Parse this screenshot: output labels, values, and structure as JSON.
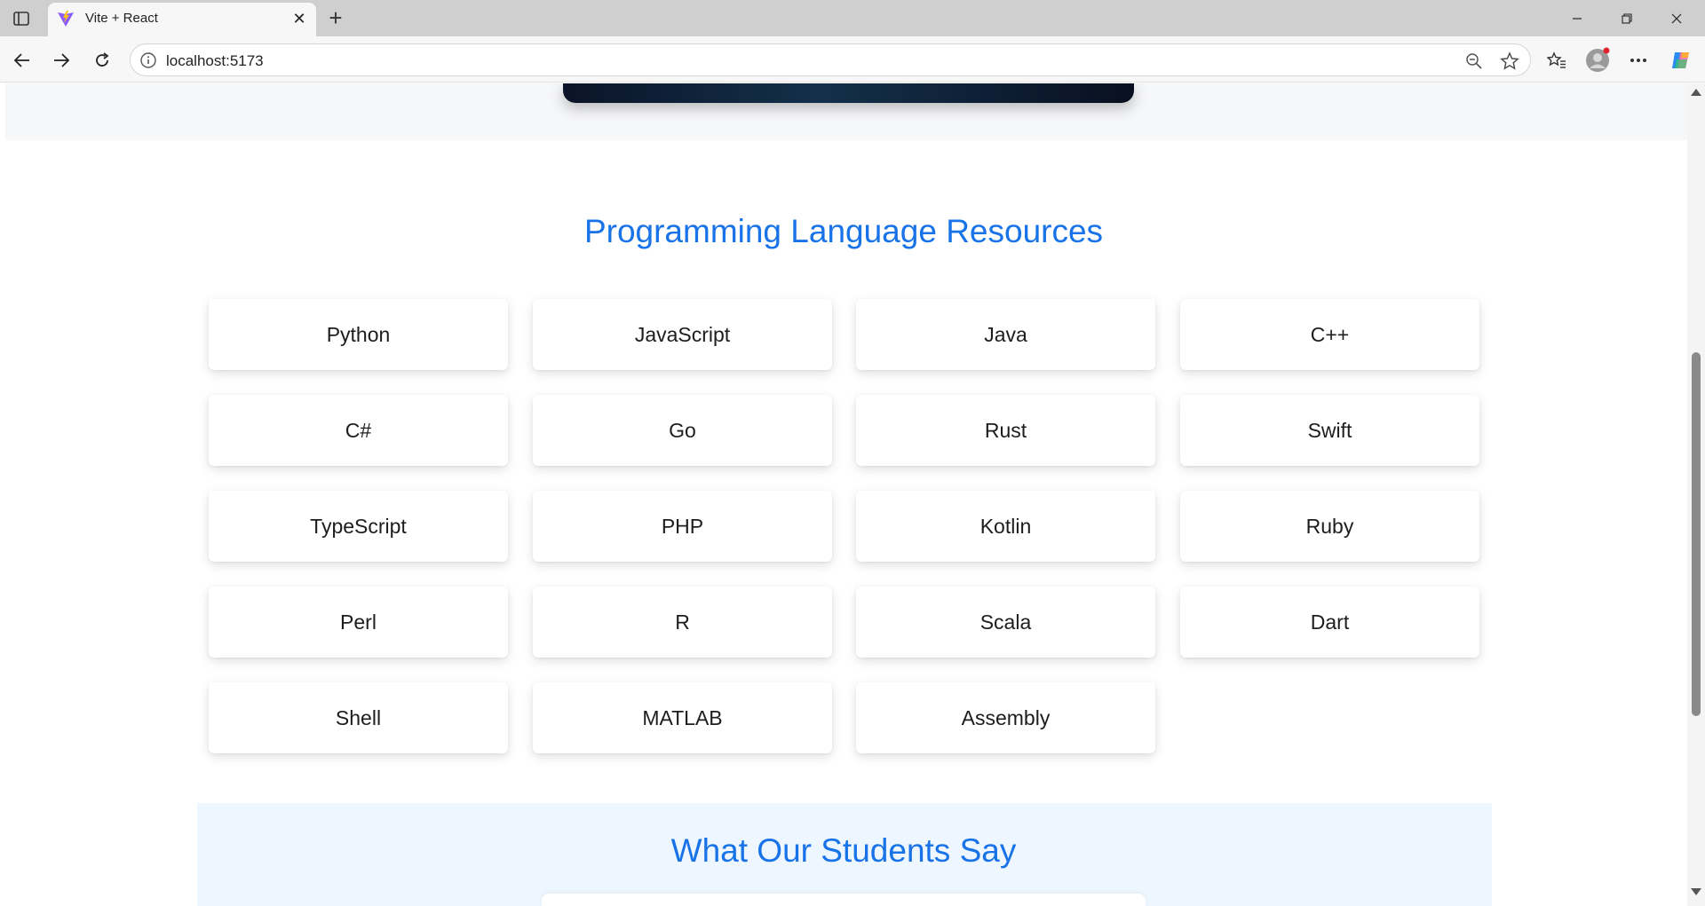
{
  "browser": {
    "tab": {
      "title": "Vite + React",
      "favicon": "vite-logo-icon"
    },
    "address_bar": {
      "url": "localhost:5173"
    },
    "icons": [
      "sidebar-icon",
      "close-icon",
      "plus-icon",
      "minimize-icon",
      "restore-icon",
      "window-close-icon",
      "back-icon",
      "forward-icon",
      "refresh-icon",
      "info-icon",
      "zoom-out-icon",
      "star-icon",
      "favorites-icon",
      "profile-icon",
      "more-icon",
      "copilot-icon"
    ]
  },
  "page": {
    "resources": {
      "title": "Programming Language Resources",
      "languages": [
        "Python",
        "JavaScript",
        "Java",
        "C++",
        "C#",
        "Go",
        "Rust",
        "Swift",
        "TypeScript",
        "PHP",
        "Kotlin",
        "Ruby",
        "Perl",
        "R",
        "Scala",
        "Dart",
        "Shell",
        "MATLAB",
        "Assembly"
      ]
    },
    "testimonials": {
      "title": "What Our Students Say"
    }
  },
  "colors": {
    "accent": "#1873e8",
    "tabbar_bg": "#cfcfcf",
    "testimonial_bg": "#eef6ff"
  }
}
